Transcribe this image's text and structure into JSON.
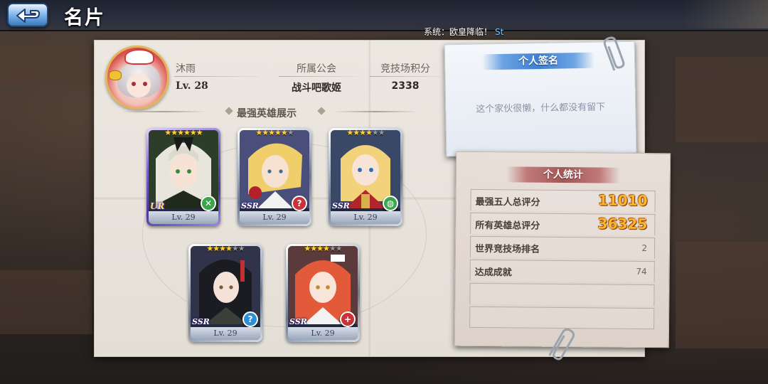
{
  "header": {
    "title": "名片"
  },
  "ticker": {
    "text": "系统：欧皇降临！",
    "tail": "St"
  },
  "profile": {
    "name": "沐雨",
    "level": "Lv. 28",
    "guild_label": "所属公会",
    "guild_value": "战斗吧歌姬",
    "arena_label": "竞技场积分",
    "arena_value": "2338"
  },
  "heroes": {
    "section_title": "最强英雄展示",
    "cards": [
      {
        "rarity": "UR",
        "stars": 6,
        "max_stars": 6,
        "level": "Lv. 29",
        "class_icon": "sword-cross-icon",
        "class_color": "#3aa54a",
        "glyph": "✕"
      },
      {
        "rarity": "SSR",
        "stars": 5,
        "max_stars": 6,
        "level": "Lv. 29",
        "class_icon": "question-mark-icon",
        "class_color": "#c8323a",
        "glyph": "?"
      },
      {
        "rarity": "SSR",
        "stars": 4,
        "max_stars": 6,
        "level": "Lv. 29",
        "class_icon": "shield-icon",
        "class_color": "#3aa54a",
        "glyph": "◍"
      },
      {
        "rarity": "SSR",
        "stars": 4,
        "max_stars": 6,
        "level": "Lv. 29",
        "class_icon": "question-mark-icon",
        "class_color": "#2f8fd6",
        "glyph": "?"
      },
      {
        "rarity": "SSR",
        "stars": 4,
        "max_stars": 6,
        "level": "Lv. 29",
        "class_icon": "plus-cross-icon",
        "class_color": "#c8323a",
        "glyph": "+"
      }
    ]
  },
  "signature": {
    "title": "个人签名",
    "text": "这个家伙很懒，什么都没有留下"
  },
  "stats": {
    "title": "个人统计",
    "rows": [
      {
        "label": "最强五人总评分",
        "value": "11010",
        "highlight": true
      },
      {
        "label": "所有英雄总评分",
        "value": "36325",
        "highlight": true
      },
      {
        "label": "世界竞技场排名",
        "value": "2",
        "highlight": false
      },
      {
        "label": "达成成就",
        "value": "74",
        "highlight": false
      },
      {
        "label": "",
        "value": "",
        "highlight": false
      },
      {
        "label": "",
        "value": "",
        "highlight": false
      }
    ]
  },
  "colors": {
    "accent_blue": "#3e7fd0",
    "accent_red": "#a35656",
    "stat_gold": "#ffb531"
  }
}
